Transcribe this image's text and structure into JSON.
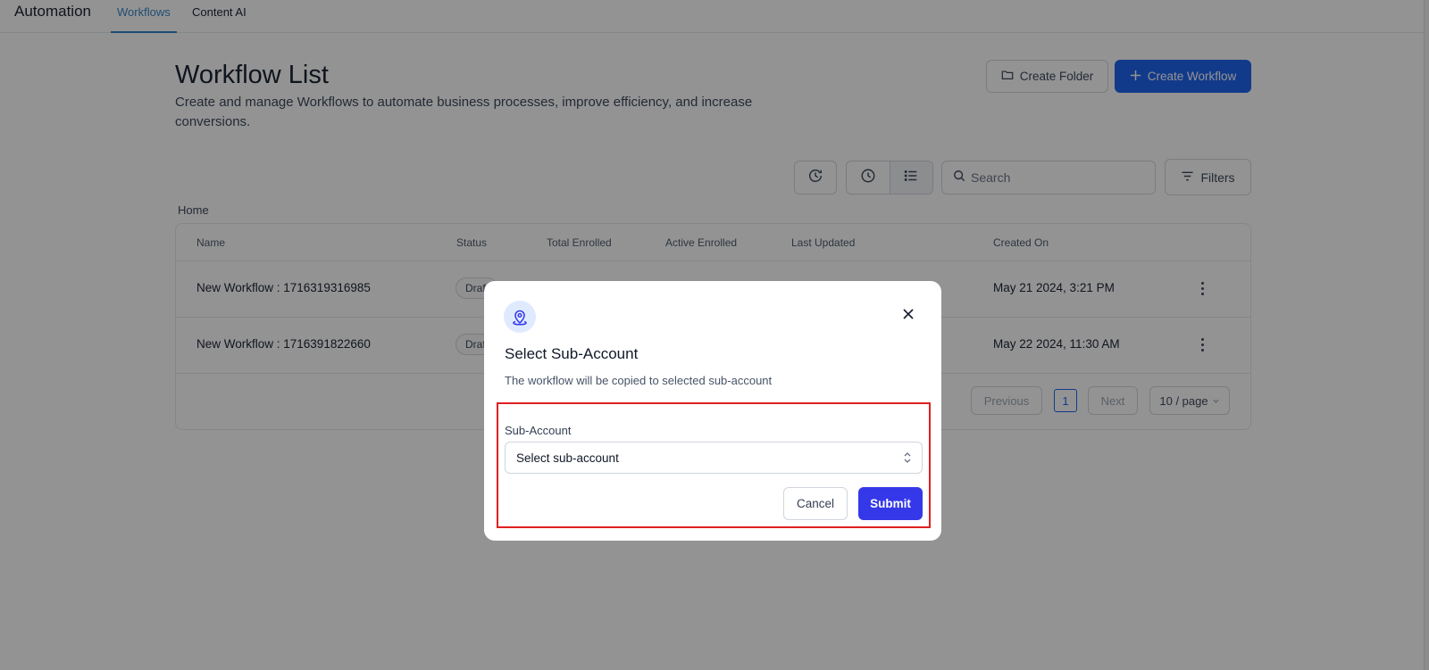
{
  "header": {
    "app_title": "Automation",
    "tabs": [
      {
        "label": "Workflows",
        "active": true
      },
      {
        "label": "Content AI",
        "active": false
      }
    ]
  },
  "page": {
    "title": "Workflow List",
    "description": "Create and manage Workflows to automate business processes, improve efficiency, and increase conversions.",
    "create_folder_label": "Create Folder",
    "create_workflow_label": "Create Workflow",
    "search_placeholder": "Search",
    "filters_label": "Filters",
    "breadcrumb": "Home"
  },
  "table": {
    "columns": [
      "Name",
      "Status",
      "Total Enrolled",
      "Active Enrolled",
      "Last Updated",
      "Created On"
    ],
    "rows": [
      {
        "name": "New Workflow : 1716319316985",
        "status": "Draft",
        "created_on": "May 21 2024, 3:21 PM"
      },
      {
        "name": "New Workflow : 1716391822660",
        "status": "Draft",
        "created_on": "May 22 2024, 11:30 AM"
      }
    ],
    "pagination": {
      "previous": "Previous",
      "current_page": "1",
      "next": "Next",
      "page_size": "10 / page"
    }
  },
  "modal": {
    "title": "Select Sub-Account",
    "description": "The workflow will be copied to selected sub-account",
    "field_label": "Sub-Account",
    "select_value": "Select sub-account",
    "cancel_label": "Cancel",
    "submit_label": "Submit"
  },
  "colors": {
    "primary": "#155eef",
    "submit": "#3538e8",
    "highlight_border": "#e02020",
    "active_tab": "#2f80c7"
  },
  "icons": {
    "folder": "folder-icon",
    "plus": "plus-icon",
    "history": "history-icon",
    "clock": "clock-icon",
    "list": "list-icon",
    "search": "search-icon",
    "filter": "filter-icon",
    "more": "more-vertical-icon",
    "location": "location-pin-icon",
    "close": "close-icon",
    "caret": "chevron-up-down-icon"
  }
}
